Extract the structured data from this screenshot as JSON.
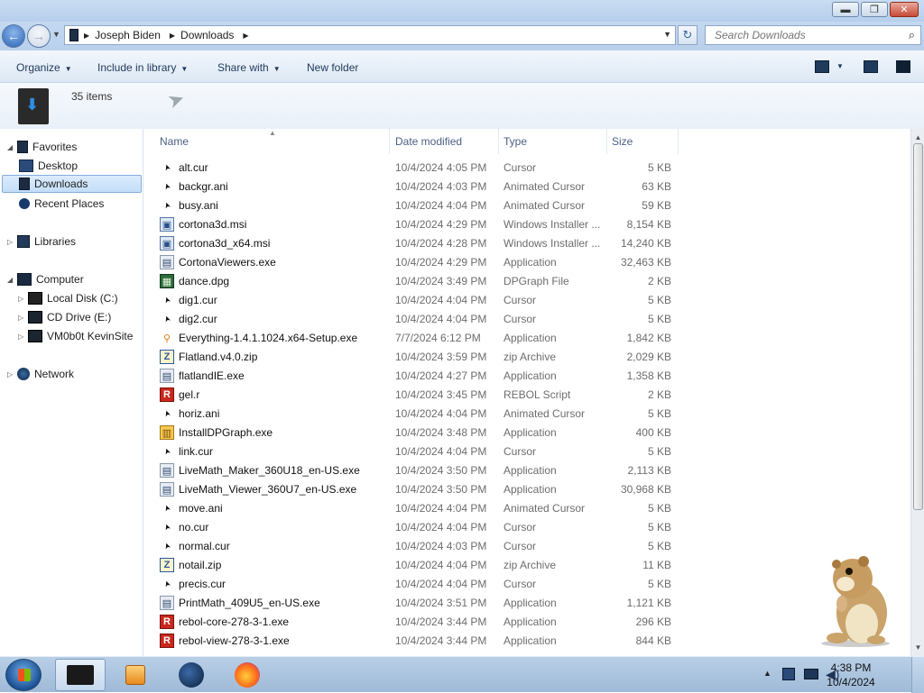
{
  "window": {
    "controls": {
      "minimize": "▬",
      "maximize": "❐",
      "close": "✕"
    }
  },
  "address": {
    "crumbs": [
      "Joseph Biden",
      "Downloads"
    ],
    "search_placeholder": "Search Downloads"
  },
  "toolbar": {
    "organize": "Organize",
    "include_in_library": "Include in library",
    "share_with": "Share with",
    "new_folder": "New folder"
  },
  "details": {
    "item_count": "35 items"
  },
  "nav": {
    "favorites": "Favorites",
    "desktop": "Desktop",
    "downloads": "Downloads",
    "recent_places": "Recent Places",
    "libraries": "Libraries",
    "computer": "Computer",
    "local_disk": "Local Disk (C:)",
    "cd_drive": "CD Drive (E:)",
    "vm": "VM0b0t KevinSite",
    "network": "Network"
  },
  "columns": {
    "name": "Name",
    "date": "Date modified",
    "type": "Type",
    "size": "Size"
  },
  "files": [
    {
      "name": "alt.cur",
      "date": "10/4/2024 4:05 PM",
      "type": "Cursor",
      "size": "5 KB",
      "icon": "cursor-icon"
    },
    {
      "name": "backgr.ani",
      "date": "10/4/2024 4:03 PM",
      "type": "Animated Cursor",
      "size": "63 KB",
      "icon": "cursor-icon"
    },
    {
      "name": "busy.ani",
      "date": "10/4/2024 4:04 PM",
      "type": "Animated Cursor",
      "size": "59 KB",
      "icon": "cursor-icon"
    },
    {
      "name": "cortona3d.msi",
      "date": "10/4/2024 4:29 PM",
      "type": "Windows Installer ...",
      "size": "8,154 KB",
      "icon": "msi-icon"
    },
    {
      "name": "cortona3d_x64.msi",
      "date": "10/4/2024 4:28 PM",
      "type": "Windows Installer ...",
      "size": "14,240 KB",
      "icon": "msi-icon"
    },
    {
      "name": "CortonaViewers.exe",
      "date": "10/4/2024 4:29 PM",
      "type": "Application",
      "size": "32,463 KB",
      "icon": "exe-icon"
    },
    {
      "name": "dance.dpg",
      "date": "10/4/2024 3:49 PM",
      "type": "DPGraph File",
      "size": "2 KB",
      "icon": "dpg-icon"
    },
    {
      "name": "dig1.cur",
      "date": "10/4/2024 4:04 PM",
      "type": "Cursor",
      "size": "5 KB",
      "icon": "cursor-icon"
    },
    {
      "name": "dig2.cur",
      "date": "10/4/2024 4:04 PM",
      "type": "Cursor",
      "size": "5 KB",
      "icon": "cursor-icon"
    },
    {
      "name": "Everything-1.4.1.1024.x64-Setup.exe",
      "date": "7/7/2024 6:12 PM",
      "type": "Application",
      "size": "1,842 KB",
      "icon": "magnifier-icon"
    },
    {
      "name": "Flatland.v4.0.zip",
      "date": "10/4/2024 3:59 PM",
      "type": "zip Archive",
      "size": "2,029 KB",
      "icon": "zip-icon"
    },
    {
      "name": "flatlandIE.exe",
      "date": "10/4/2024 4:27 PM",
      "type": "Application",
      "size": "1,358 KB",
      "icon": "exe-icon"
    },
    {
      "name": "gel.r",
      "date": "10/4/2024 3:45 PM",
      "type": "REBOL Script",
      "size": "2 KB",
      "icon": "rebol-icon"
    },
    {
      "name": "horiz.ani",
      "date": "10/4/2024 4:04 PM",
      "type": "Animated Cursor",
      "size": "5 KB",
      "icon": "cursor-icon"
    },
    {
      "name": "InstallDPGraph.exe",
      "date": "10/4/2024 3:48 PM",
      "type": "Application",
      "size": "400 KB",
      "icon": "installer-icon"
    },
    {
      "name": "link.cur",
      "date": "10/4/2024 4:04 PM",
      "type": "Cursor",
      "size": "5 KB",
      "icon": "cursor-icon"
    },
    {
      "name": "LiveMath_Maker_360U18_en-US.exe",
      "date": "10/4/2024 3:50 PM",
      "type": "Application",
      "size": "2,113 KB",
      "icon": "exe-icon"
    },
    {
      "name": "LiveMath_Viewer_360U7_en-US.exe",
      "date": "10/4/2024 3:50 PM",
      "type": "Application",
      "size": "30,968 KB",
      "icon": "exe-icon"
    },
    {
      "name": "move.ani",
      "date": "10/4/2024 4:04 PM",
      "type": "Animated Cursor",
      "size": "5 KB",
      "icon": "cursor-icon"
    },
    {
      "name": "no.cur",
      "date": "10/4/2024 4:04 PM",
      "type": "Cursor",
      "size": "5 KB",
      "icon": "cursor-icon"
    },
    {
      "name": "normal.cur",
      "date": "10/4/2024 4:03 PM",
      "type": "Cursor",
      "size": "5 KB",
      "icon": "cursor-icon"
    },
    {
      "name": "notail.zip",
      "date": "10/4/2024 4:04 PM",
      "type": "zip Archive",
      "size": "11 KB",
      "icon": "zip-icon"
    },
    {
      "name": "precis.cur",
      "date": "10/4/2024 4:04 PM",
      "type": "Cursor",
      "size": "5 KB",
      "icon": "cursor-icon"
    },
    {
      "name": "PrintMath_409U5_en-US.exe",
      "date": "10/4/2024 3:51 PM",
      "type": "Application",
      "size": "1,121 KB",
      "icon": "exe-icon"
    },
    {
      "name": "rebol-core-278-3-1.exe",
      "date": "10/4/2024 3:44 PM",
      "type": "Application",
      "size": "296 KB",
      "icon": "rebol-icon"
    },
    {
      "name": "rebol-view-278-3-1.exe",
      "date": "10/4/2024 3:44 PM",
      "type": "Application",
      "size": "844 KB",
      "icon": "rebol-icon"
    }
  ],
  "taskbar": {
    "time": "4:38 PM",
    "date": "10/4/2024"
  }
}
